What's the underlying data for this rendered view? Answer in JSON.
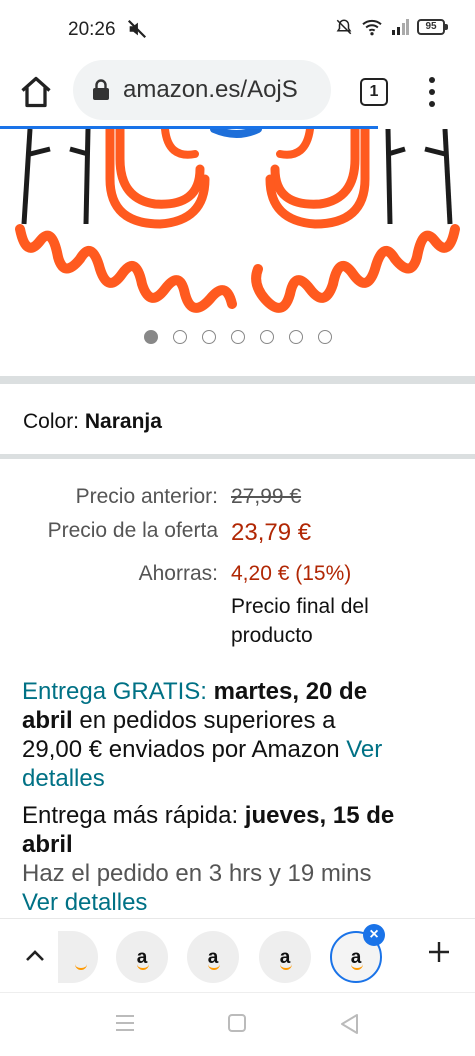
{
  "status_bar": {
    "time": "20:26",
    "battery": "95",
    "icons": [
      "mute-icon",
      "alarm-off-icon",
      "wifi-icon",
      "signal-icon",
      "battery-icon"
    ]
  },
  "browser": {
    "url": "amazon.es/AojS",
    "tab_count": "1",
    "accent_color": "#1a73e8"
  },
  "gallery": {
    "dot_count": 7,
    "active_index": 0
  },
  "product": {
    "color_label": "Color:",
    "color_value": "Naranja",
    "prices": {
      "previous_label": "Precio anterior:",
      "previous_value": "27,99 €",
      "deal_label": "Precio de la oferta",
      "deal_value": "23,79 €",
      "savings_label": "Ahorras:",
      "savings_value": "4,20 € (15%)",
      "final_note_line1": "Precio final del",
      "final_note_line2": "producto"
    },
    "delivery": {
      "free_label": "Entrega GRATIS:",
      "free_date_a": "martes, 20 de",
      "free_date_b": "abril",
      "free_text_a": "en pedidos superiores a",
      "free_text_b": "29,00 € enviados por Amazon",
      "free_link_a": "Ver",
      "free_link_b": "detalles",
      "fast_label": "Entrega más rápida:",
      "fast_date_a": "jueves, 15 de",
      "fast_date_b": "abril",
      "order_within": "Haz el pedido en 3 hrs y 19 mins",
      "fast_link": "Ver detalles"
    }
  },
  "tab_strip": {
    "tab_glyph": "a",
    "close_glyph": "×",
    "accent_color": "#ff9900"
  }
}
